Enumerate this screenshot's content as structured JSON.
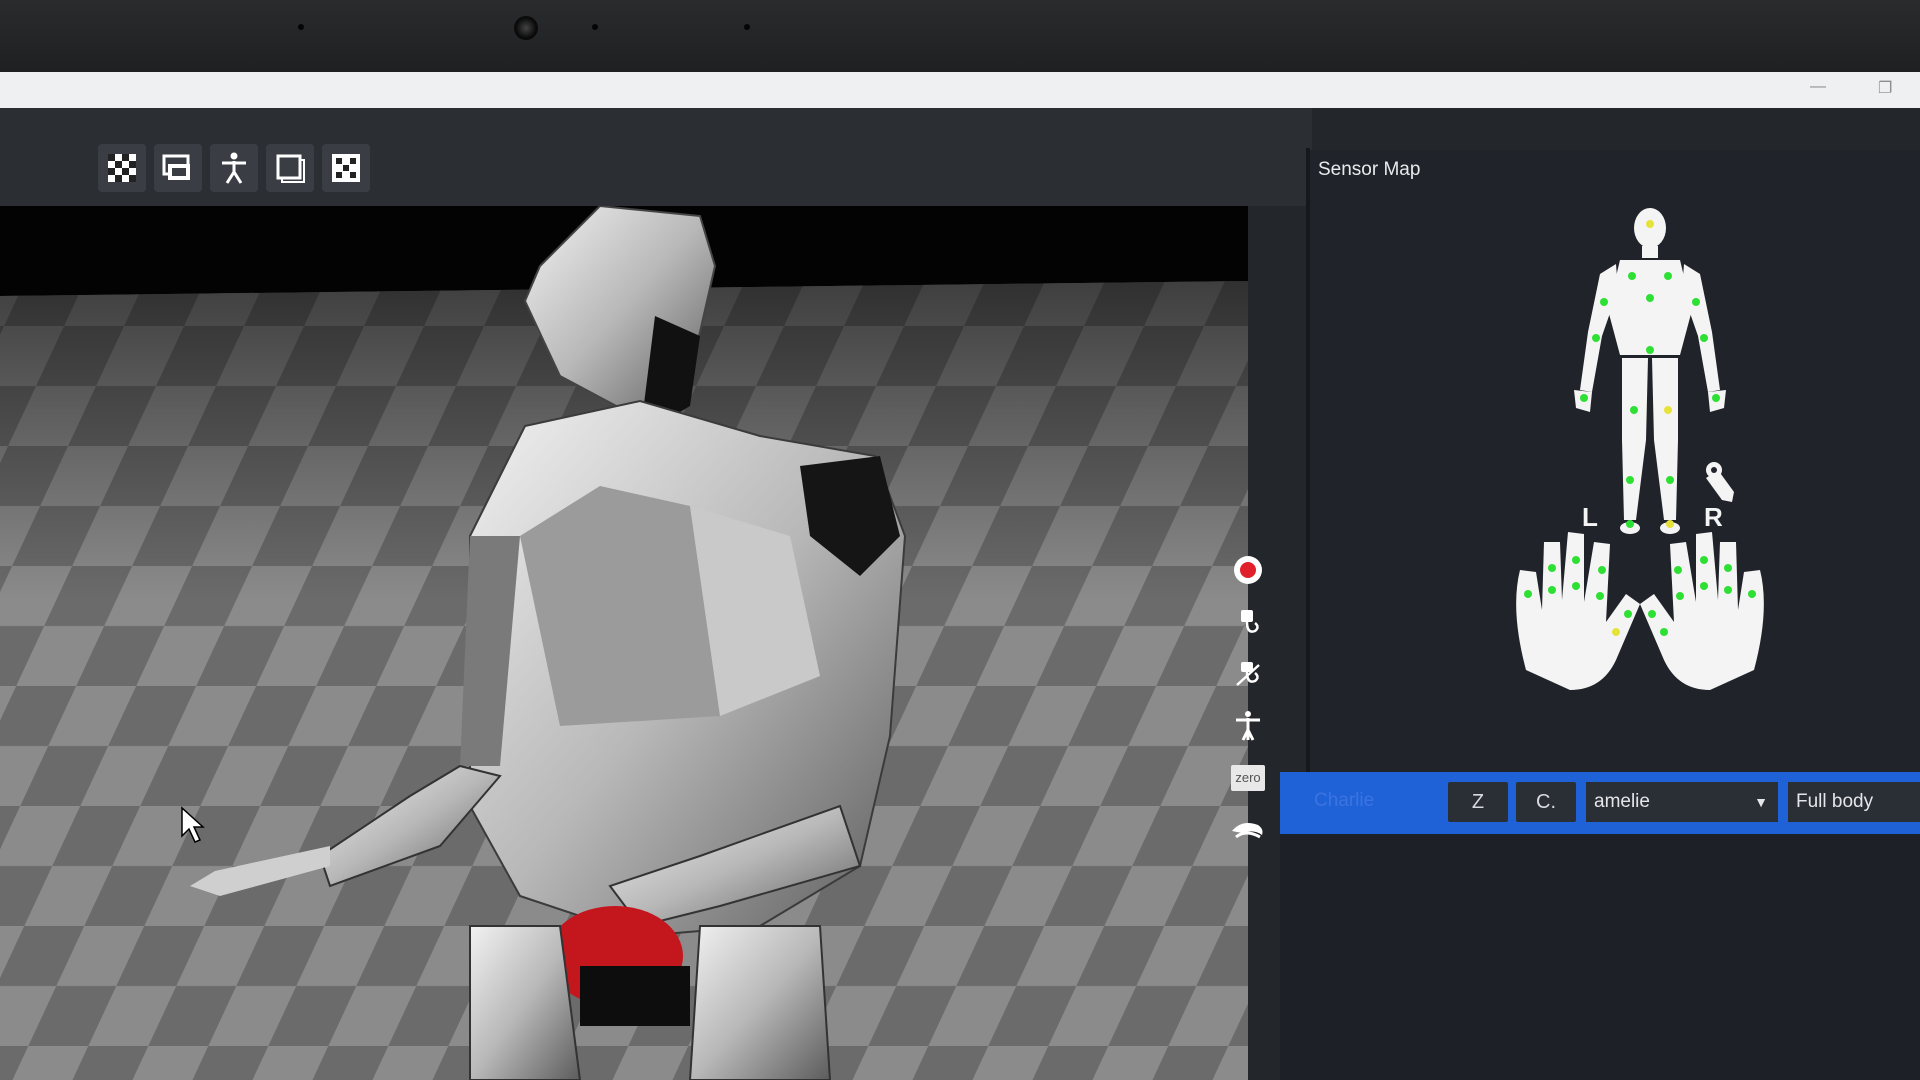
{
  "window": {
    "minimize_icon": "minimize-icon",
    "restore_icon": "restore-icon"
  },
  "toolbar": {
    "buttons": [
      {
        "name": "grid-toggle-button",
        "icon": "checker-grid-icon"
      },
      {
        "name": "camera-view-button",
        "icon": "monitor-camera-icon"
      },
      {
        "name": "actor-view-button",
        "icon": "person-icon"
      },
      {
        "name": "single-view-button",
        "icon": "window-icon"
      },
      {
        "name": "multi-grid-button",
        "icon": "checker-grid-alt-icon"
      }
    ]
  },
  "viewport": {
    "description_icon": "mouse-cursor-icon"
  },
  "sidebar": {
    "record_icon": "record-icon",
    "zero_label": "zero",
    "icons": [
      "record-icon",
      "sensor-plug-icon",
      "sensor-disconnect-icon",
      "tpose-icon",
      "zero-icon",
      "hand-glove-icon"
    ]
  },
  "panel": {
    "title": "Sensor Map",
    "left_label": "L",
    "right_label": "R",
    "wrench_icon": "wrench-icon",
    "sensor_color_active": "#2fe034",
    "sensor_color_warning": "#e6e23a"
  },
  "actor_row": {
    "name": "Charlie",
    "z_button": "Z",
    "c_button": "C.",
    "profile_value": "amelie",
    "mode_value": "Full body"
  },
  "colors": {
    "accent": "#1f62d8",
    "record": "#e0202a"
  }
}
